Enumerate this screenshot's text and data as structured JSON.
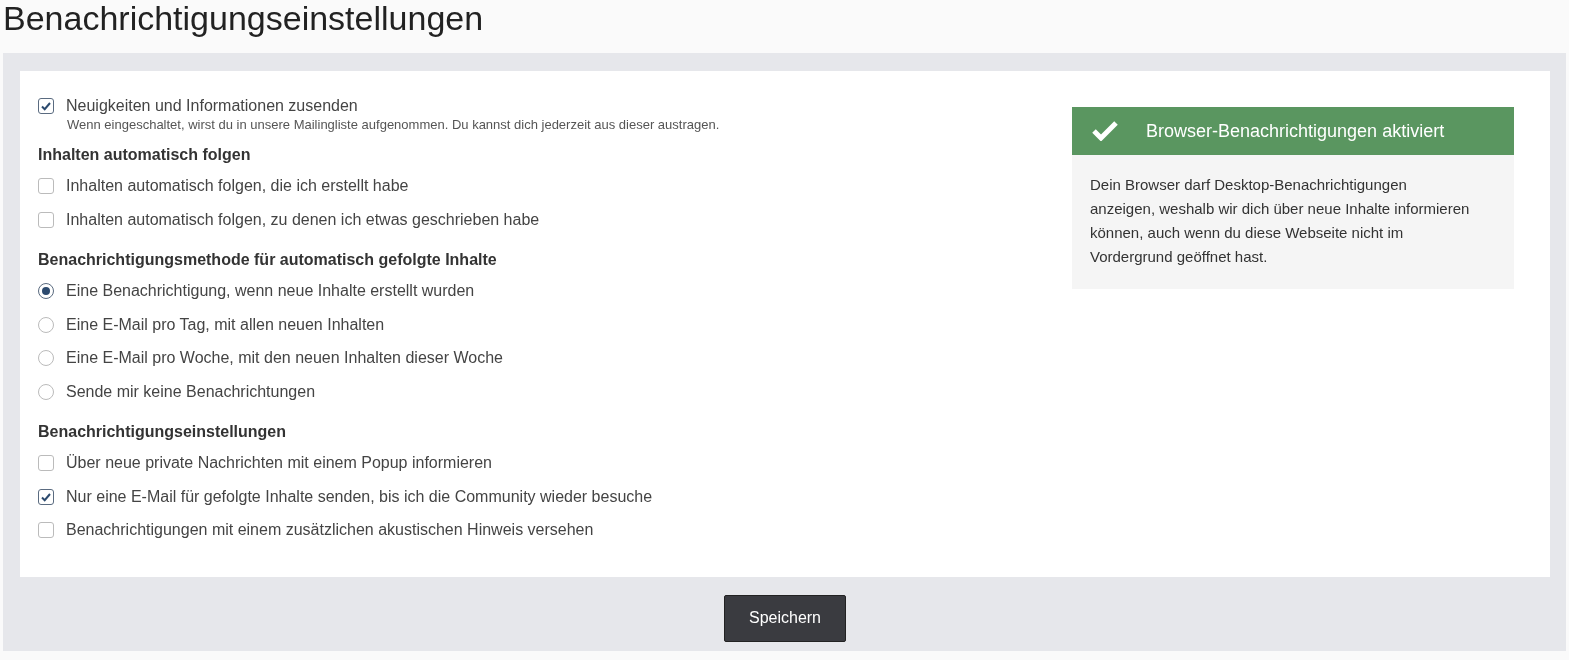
{
  "title": "Benachrichtigungseinstellungen",
  "sections": [
    {
      "items": [
        {
          "kind": "checkbox",
          "label": "Neuigkeiten und Informationen zusenden",
          "checked": true,
          "hint": "Wenn eingeschaltet, wirst du in unsere Mailingliste aufgenommen. Du kannst dich jederzeit aus dieser austragen."
        }
      ]
    },
    {
      "heading": "Inhalten automatisch folgen",
      "items": [
        {
          "kind": "checkbox",
          "label": "Inhalten automatisch folgen, die ich erstellt habe",
          "checked": false
        },
        {
          "kind": "checkbox",
          "label": "Inhalten automatisch folgen, zu denen ich etwas geschrieben habe",
          "checked": false
        }
      ]
    },
    {
      "heading": "Benachrichtigungsmethode für automatisch gefolgte Inhalte",
      "items": [
        {
          "kind": "radio",
          "label": "Eine Benachrichtigung, wenn neue Inhalte erstellt wurden",
          "selected": true
        },
        {
          "kind": "radio",
          "label": "Eine E-Mail pro Tag, mit allen neuen Inhalten",
          "selected": false
        },
        {
          "kind": "radio",
          "label": "Eine E-Mail pro Woche, mit den neuen Inhalten dieser Woche",
          "selected": false
        },
        {
          "kind": "radio",
          "label": "Sende mir keine Benachrichtungen",
          "selected": false
        }
      ]
    },
    {
      "heading": "Benachrichtigungseinstellungen",
      "items": [
        {
          "kind": "checkbox",
          "label": "Über neue private Nachrichten mit einem Popup informieren",
          "checked": false
        },
        {
          "kind": "checkbox",
          "label": "Nur eine E-Mail für gefolgte Inhalte senden, bis ich die Community wieder besuche",
          "checked": true
        },
        {
          "kind": "checkbox",
          "label": "Benachrichtigungen mit einem zusätzlichen akustischen Hinweis versehen",
          "checked": false
        }
      ]
    }
  ],
  "alert": {
    "title": "Browser-Benachrichtigungen aktiviert",
    "text": "Dein Browser darf Desktop-Benachrichtigungen anzeigen, weshalb wir dich über neue Inhalte informieren können, auch wenn du diese Webseite nicht im Vordergrund geöffnet hast."
  },
  "save_button": "Speichern"
}
